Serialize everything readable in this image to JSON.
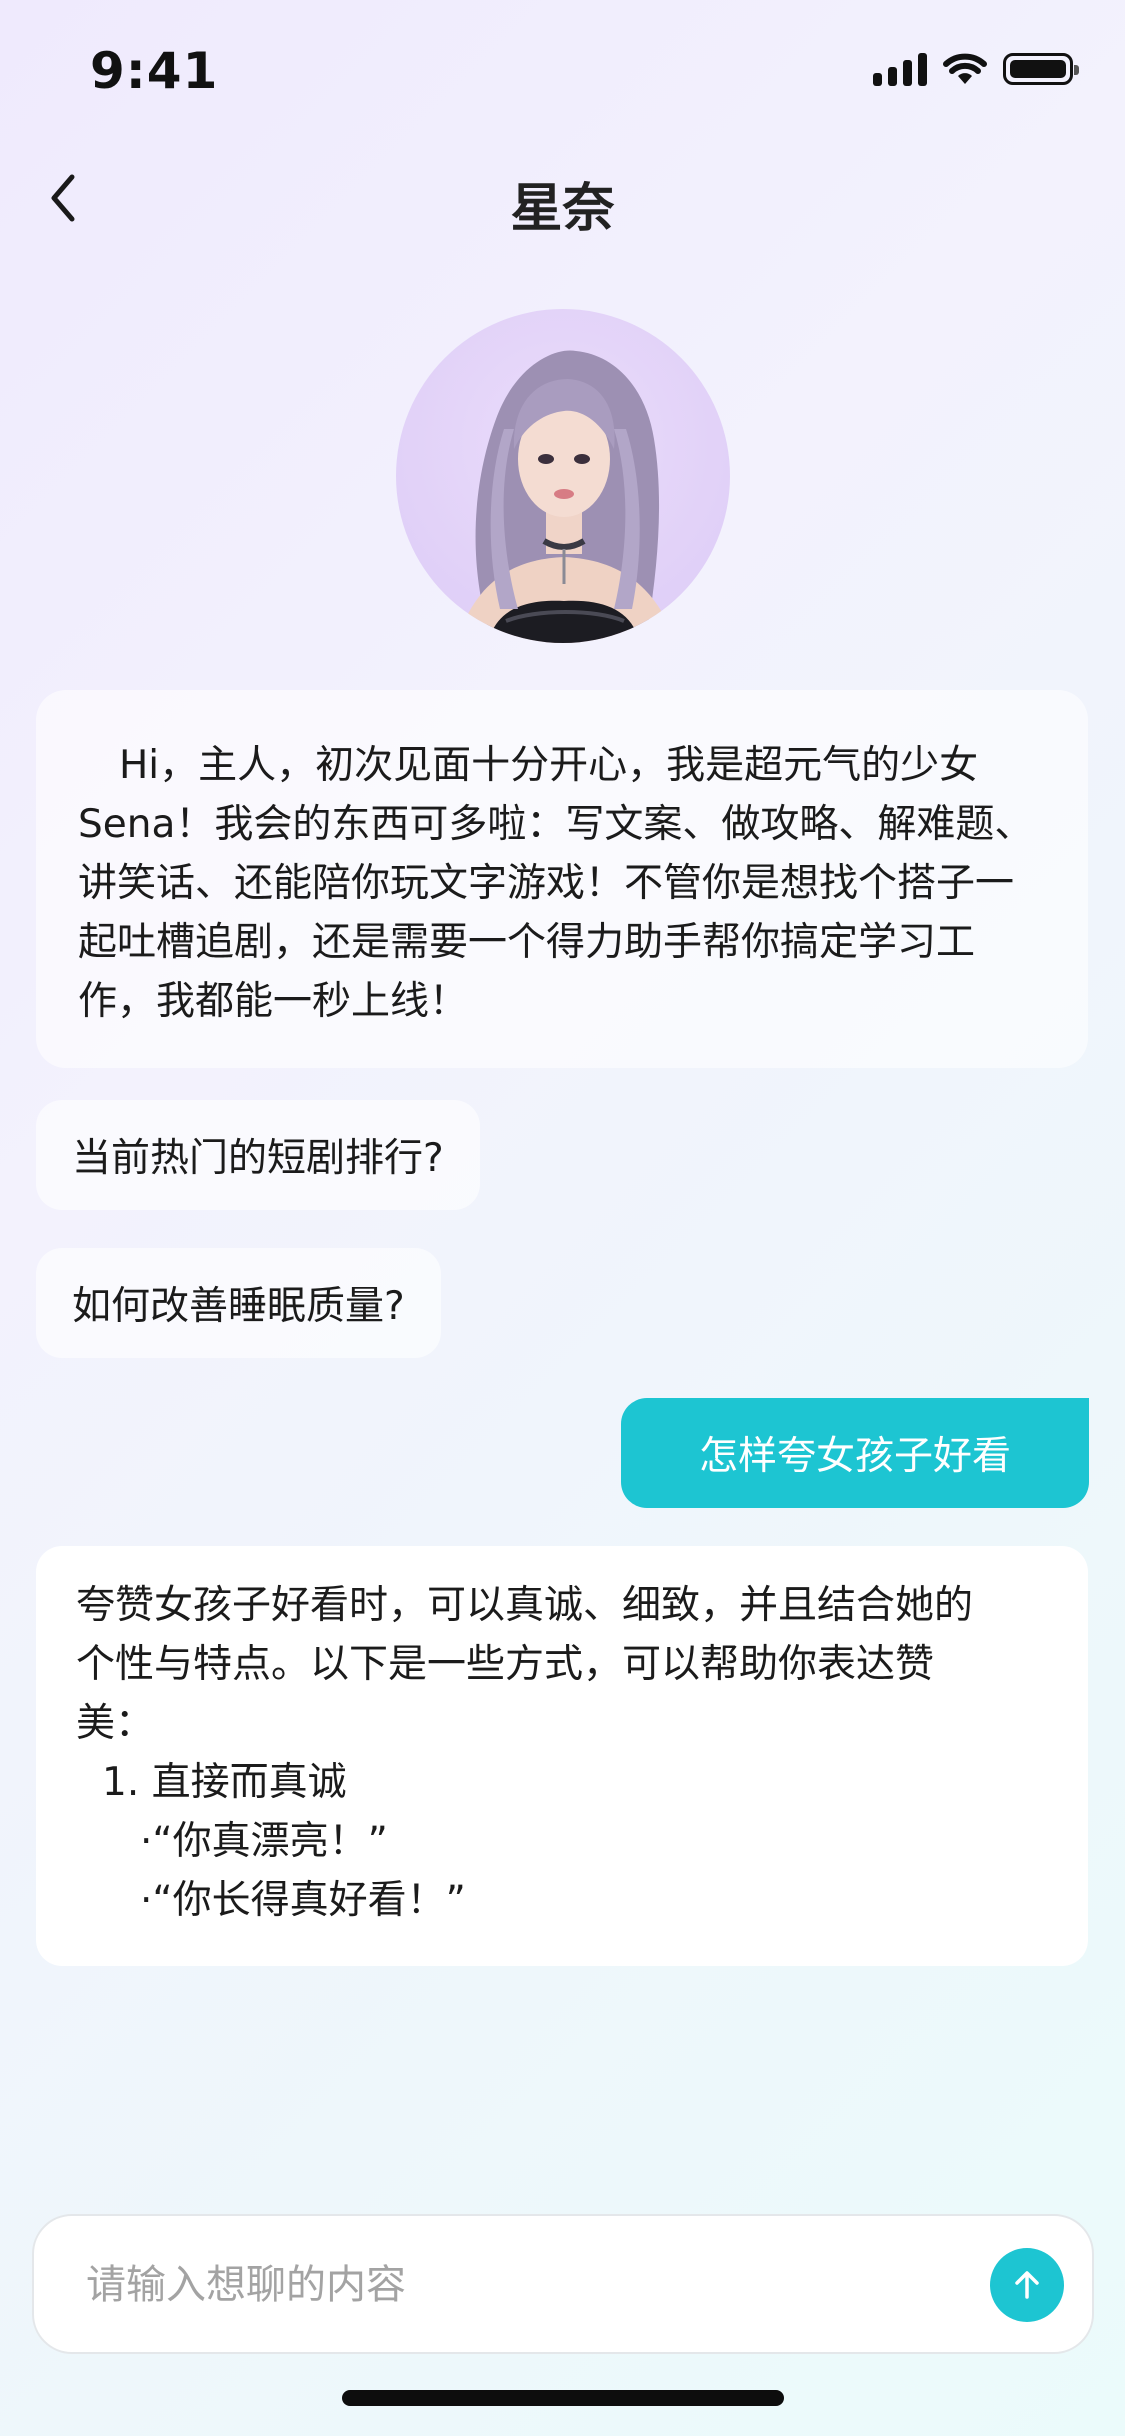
{
  "status": {
    "time": "9:41"
  },
  "header": {
    "title": "星奈"
  },
  "intro": {
    "text": "Hi，主人，初次见面十分开心，我是超元气的少女Sena！我会的东西可多啦：写文案、做攻略、解难题、讲笑话、还能陪你玩文字游戏！不管你是想找个搭子一起吐槽追剧，还是需要一个得力助手帮你搞定学习工作，我都能一秒上线！"
  },
  "suggestions": [
    {
      "label": "当前热门的短剧排行?"
    },
    {
      "label": "如何改善睡眠质量?"
    }
  ],
  "user_message": {
    "text": "怎样夸女孩子好看"
  },
  "reply": {
    "lines": [
      "夸赞女孩子好看时，可以真诚、细致，并且结合她的",
      "个性与特点。以下是一些方式，可以帮助你表达赞",
      "美："
    ],
    "item_1": "1. 直接而真诚",
    "sub_1": "·“你真漂亮！”",
    "sub_2": "·“你长得真好看！”"
  },
  "input": {
    "placeholder": "请输入想聊的内容",
    "value": ""
  },
  "colors": {
    "accent": "#1dc5d2",
    "background_start": "#efeafd",
    "background_end": "#ebfbfb"
  },
  "icons": {
    "back": "chevron-left-icon",
    "send": "arrow-up-icon",
    "signal": "cellular-signal-icon",
    "wifi": "wifi-icon",
    "battery": "battery-icon"
  }
}
